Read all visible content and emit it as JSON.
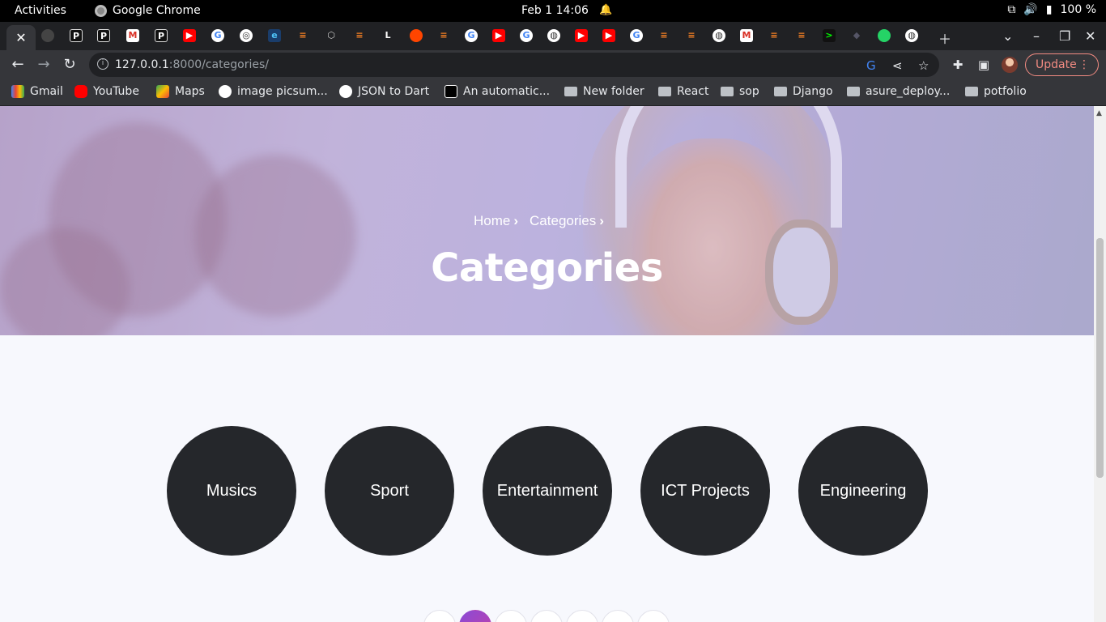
{
  "system": {
    "activities": "Activities",
    "app_name": "Google Chrome",
    "clock": "Feb 1  14:06",
    "battery": "100 %"
  },
  "browser": {
    "url_host": "127.0.0.1",
    "url_path": ":8000/categories/",
    "update_label": "Update"
  },
  "bookmarks": [
    {
      "label": "Gmail",
      "icon": "gmail-icon"
    },
    {
      "label": "YouTube",
      "icon": "youtube-icon"
    },
    {
      "label": "Maps",
      "icon": "maps-icon"
    },
    {
      "label": "image picsum...",
      "icon": "google-icon"
    },
    {
      "label": "JSON to Dart",
      "icon": "globe-icon"
    },
    {
      "label": "An automatic...",
      "icon": "medium-icon"
    },
    {
      "label": "New folder",
      "icon": "folder-icon"
    },
    {
      "label": "React",
      "icon": "folder-icon"
    },
    {
      "label": "sop",
      "icon": "folder-icon"
    },
    {
      "label": "Django",
      "icon": "folder-icon"
    },
    {
      "label": "asure_deploy...",
      "icon": "folder-icon"
    },
    {
      "label": "potfolio",
      "icon": "folder-icon"
    }
  ],
  "hero": {
    "breadcrumb_home": "Home",
    "breadcrumb_current": "Categories",
    "title": "Categories"
  },
  "categories": [
    "Musics",
    "Sport",
    "Entertainment",
    "ICT Projects",
    "Engineering"
  ],
  "colors": {
    "circle_bg": "#25272b",
    "pager_active": "#8a4bd6",
    "update_accent": "#f28b82"
  }
}
